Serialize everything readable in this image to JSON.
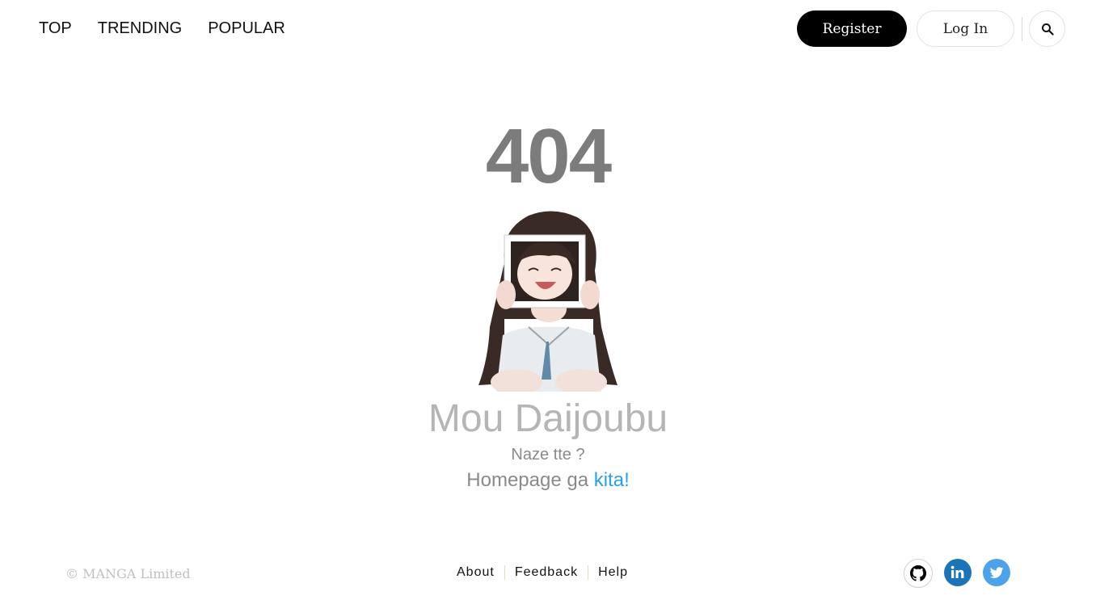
{
  "nav": {
    "items": [
      {
        "label": "TOP"
      },
      {
        "label": "TRENDING"
      },
      {
        "label": "POPULAR"
      }
    ]
  },
  "auth": {
    "register_label": "Register",
    "login_label": "Log In",
    "search_icon": "search-icon"
  },
  "error": {
    "code": "404",
    "headline": "Mou Daijoubu",
    "subtitle": "Naze tte ?",
    "home_prefix": "Homepage ga",
    "home_link": "kita!"
  },
  "footer": {
    "copyright": "© MANGA Limited",
    "links": [
      {
        "label": "About"
      },
      {
        "label": "Feedback"
      },
      {
        "label": "Help"
      }
    ],
    "social": [
      {
        "icon": "github-icon",
        "color": "#000000"
      },
      {
        "icon": "linkedin-icon",
        "color": "#1b73b8"
      },
      {
        "icon": "twitter-icon",
        "color": "#4da3ea"
      }
    ]
  },
  "colors": {
    "accent_link": "#2aa0e8",
    "code_gray": "#7c7c7c",
    "headline_gray": "#b5b5b5"
  }
}
